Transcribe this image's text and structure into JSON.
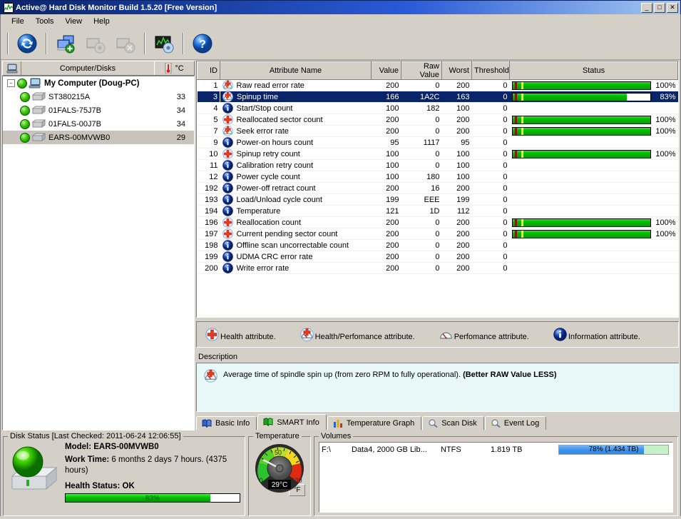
{
  "window": {
    "title": "Active@ Hard Disk Monitor Build 1.5.20 [Free Version]",
    "icon": "app-chart-icon",
    "minimize_label": "_",
    "maximize_label": "□",
    "close_label": "✕"
  },
  "menu": {
    "items": [
      {
        "label": "File"
      },
      {
        "label": "Tools"
      },
      {
        "label": "View"
      },
      {
        "label": "Help"
      }
    ]
  },
  "toolbar": {
    "buttons": [
      {
        "name": "refresh-button",
        "icon": "refresh-icon",
        "enabled": true
      },
      {
        "name": "add-disk-button",
        "icon": "add-disk-icon",
        "enabled": true
      },
      {
        "name": "disk-settings-button",
        "icon": "disk-settings-icon",
        "enabled": false
      },
      {
        "name": "remove-disk-button",
        "icon": "remove-disk-icon",
        "enabled": false
      },
      {
        "name": "monitor-settings-button",
        "icon": "monitor-settings-icon",
        "enabled": true
      },
      {
        "name": "help-button",
        "icon": "help-icon",
        "enabled": true
      }
    ]
  },
  "left_pane": {
    "header_title": "Computer/Disks",
    "header_icon": "computer-icon",
    "temp_unit": "°C",
    "temp_icon": "thermometer-icon",
    "tree": {
      "root": {
        "label": "My Computer (Doug-PC)",
        "expander": "-"
      },
      "disks": [
        {
          "label": "ST380215A",
          "temp": "33",
          "selected": false
        },
        {
          "label": "01FALS-75J7B",
          "temp": "34",
          "selected": false
        },
        {
          "label": "01FALS-00J7B",
          "temp": "34",
          "selected": false
        },
        {
          "label": "EARS-00MVWB0",
          "temp": "29",
          "selected": true
        }
      ]
    }
  },
  "smart_grid": {
    "columns": [
      "ID",
      "Attribute Name",
      "Value",
      "Raw Value",
      "Worst",
      "Threshold",
      "Status"
    ],
    "rows": [
      {
        "id": "1",
        "name": "Raw read error rate",
        "icon": "health-performance-attribute-icon",
        "value": "200",
        "raw": "0",
        "worst": "200",
        "threshold": "0",
        "status_pct": 100,
        "status_label": "100%",
        "selected": false
      },
      {
        "id": "3",
        "name": "Spinup time",
        "icon": "health-performance-attribute-icon",
        "value": "166",
        "raw": "1A2C",
        "worst": "163",
        "threshold": "0",
        "status_pct": 83,
        "status_label": "83%",
        "selected": true
      },
      {
        "id": "4",
        "name": "Start/Stop count",
        "icon": "information-attribute-icon",
        "value": "100",
        "raw": "182",
        "worst": "100",
        "threshold": "0",
        "status_pct": null,
        "status_label": "",
        "selected": false
      },
      {
        "id": "5",
        "name": "Reallocated sector count",
        "icon": "health-attribute-icon",
        "value": "200",
        "raw": "0",
        "worst": "200",
        "threshold": "0",
        "status_pct": 100,
        "status_label": "100%",
        "selected": false
      },
      {
        "id": "7",
        "name": "Seek error rate",
        "icon": "health-performance-attribute-icon",
        "value": "200",
        "raw": "0",
        "worst": "200",
        "threshold": "0",
        "status_pct": 100,
        "status_label": "100%",
        "selected": false
      },
      {
        "id": "9",
        "name": "Power-on hours count",
        "icon": "information-attribute-icon",
        "value": "95",
        "raw": "1117",
        "worst": "95",
        "threshold": "0",
        "status_pct": null,
        "status_label": "",
        "selected": false
      },
      {
        "id": "10",
        "name": "Spinup retry count",
        "icon": "health-attribute-icon",
        "value": "100",
        "raw": "0",
        "worst": "100",
        "threshold": "0",
        "status_pct": 100,
        "status_label": "100%",
        "selected": false
      },
      {
        "id": "11",
        "name": "Calibration retry count",
        "icon": "information-attribute-icon",
        "value": "100",
        "raw": "0",
        "worst": "100",
        "threshold": "0",
        "status_pct": null,
        "status_label": "",
        "selected": false
      },
      {
        "id": "12",
        "name": "Power cycle count",
        "icon": "information-attribute-icon",
        "value": "100",
        "raw": "180",
        "worst": "100",
        "threshold": "0",
        "status_pct": null,
        "status_label": "",
        "selected": false
      },
      {
        "id": "192",
        "name": "Power-off retract count",
        "icon": "information-attribute-icon",
        "value": "200",
        "raw": "16",
        "worst": "200",
        "threshold": "0",
        "status_pct": null,
        "status_label": "",
        "selected": false
      },
      {
        "id": "193",
        "name": "Load/Unload cycle count",
        "icon": "information-attribute-icon",
        "value": "199",
        "raw": "EEE",
        "worst": "199",
        "threshold": "0",
        "status_pct": null,
        "status_label": "",
        "selected": false
      },
      {
        "id": "194",
        "name": "Temperature",
        "icon": "information-attribute-icon",
        "value": "121",
        "raw": "1D",
        "worst": "112",
        "threshold": "0",
        "status_pct": null,
        "status_label": "",
        "selected": false
      },
      {
        "id": "196",
        "name": "Reallocation count",
        "icon": "health-attribute-icon",
        "value": "200",
        "raw": "0",
        "worst": "200",
        "threshold": "0",
        "status_pct": 100,
        "status_label": "100%",
        "selected": false
      },
      {
        "id": "197",
        "name": "Current pending sector count",
        "icon": "health-attribute-icon",
        "value": "200",
        "raw": "0",
        "worst": "200",
        "threshold": "0",
        "status_pct": 100,
        "status_label": "100%",
        "selected": false
      },
      {
        "id": "198",
        "name": "Offline scan uncorrectable count",
        "icon": "information-attribute-icon",
        "value": "200",
        "raw": "0",
        "worst": "200",
        "threshold": "0",
        "status_pct": null,
        "status_label": "",
        "selected": false
      },
      {
        "id": "199",
        "name": "UDMA CRC error rate",
        "icon": "information-attribute-icon",
        "value": "200",
        "raw": "0",
        "worst": "200",
        "threshold": "0",
        "status_pct": null,
        "status_label": "",
        "selected": false
      },
      {
        "id": "200",
        "name": "Write error rate",
        "icon": "information-attribute-icon",
        "value": "200",
        "raw": "0",
        "worst": "200",
        "threshold": "0",
        "status_pct": null,
        "status_label": "",
        "selected": false
      }
    ]
  },
  "legend": {
    "items": [
      {
        "icon": "health-attribute-icon",
        "label": "Health attribute."
      },
      {
        "icon": "health-performance-attribute-icon",
        "label": "Health/Perfomance attribute."
      },
      {
        "icon": "performance-attribute-icon",
        "label": "Perfomance attribute."
      },
      {
        "icon": "information-attribute-icon",
        "label": "Information attribute."
      }
    ]
  },
  "description": {
    "label": "Description",
    "icon": "health-performance-attribute-icon",
    "text": "Average time of spindle spin up (from zero RPM to fully operational). ",
    "emphasis": "(Better RAW Value LESS)"
  },
  "tabs": [
    {
      "label": "Basic Info",
      "icon": "blue-book-icon",
      "active": false
    },
    {
      "label": "SMART Info",
      "icon": "green-book-icon",
      "active": true
    },
    {
      "label": "Temperature Graph",
      "icon": "bar-chart-icon",
      "active": false
    },
    {
      "label": "Scan Disk",
      "icon": "magnifier-icon",
      "active": false
    },
    {
      "label": "Event Log",
      "icon": "event-log-icon",
      "active": false
    }
  ],
  "disk_status": {
    "legend": "Disk Status [Last Checked: 2011-06-24 12:06:55]",
    "icon": "hard-disk-ok-icon",
    "model_label": "Model:",
    "model_value": "EARS-00MVWB0",
    "worktime_label": "Work Time:",
    "worktime_value": "6 months 2 days 7 hours. (4375 hours)",
    "health_label": "Health Status: OK",
    "health_pct": 83,
    "health_pct_label": "83%"
  },
  "temperature": {
    "legend": "Temperature",
    "value_label": "29°C",
    "value": 29,
    "scale_min": "0",
    "scale_mid": "50",
    "scale_max": "100",
    "unit_toggle": "°F"
  },
  "volumes": {
    "legend": "Volumes",
    "rows": [
      {
        "drive": "F:\\",
        "label": "Data4, 2000 GB Lib...",
        "fs": "NTFS",
        "size": "1.819 TB",
        "used_pct": 78,
        "usage_label": "78% (1.434 TB)"
      }
    ]
  },
  "colors": {
    "title_start": "#0a246a",
    "accent_green": "#00b800",
    "selection_blue": "#0a246a",
    "face": "#d4d0c8",
    "desc_bg": "#e8f8f8",
    "volume_blue": "#3f93ee"
  }
}
